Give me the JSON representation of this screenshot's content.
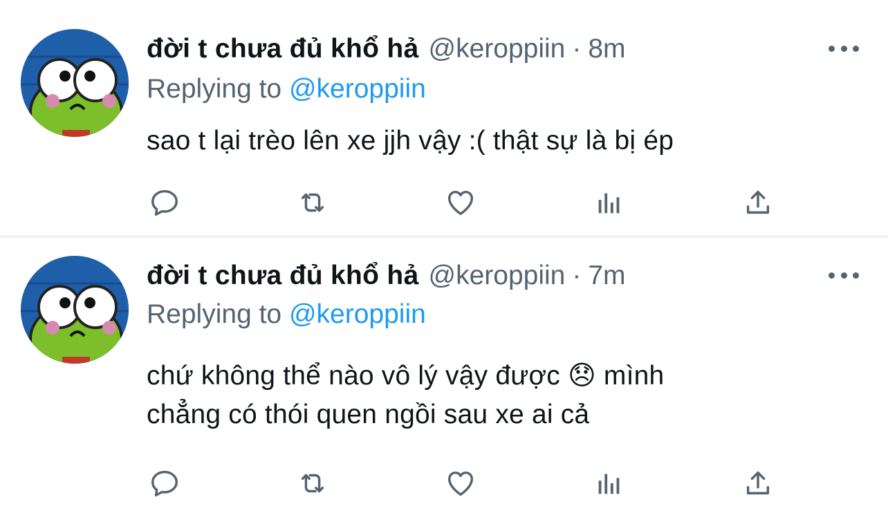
{
  "tweets": [
    {
      "name": "đời t chưa đủ khổ hả",
      "handle": "@keroppiin",
      "separator": "·",
      "time": "8m",
      "replying_label": "Replying to",
      "replying_to": "@keroppiin",
      "text_lines": [
        "sao t lại trèo lên xe jjh vậy :( thật sự là bị ép"
      ]
    },
    {
      "name": "đời t chưa đủ khổ hả",
      "handle": "@keroppiin",
      "separator": "·",
      "time": "7m",
      "replying_label": "Replying to",
      "replying_to": "@keroppiin",
      "text_lines": [
        "chứ không thể nào vô lý vậy được 😞  mình",
        "chẳng có thói quen ngồi sau xe ai cả"
      ]
    }
  ],
  "actions": [
    "reply-icon",
    "retweet-icon",
    "like-icon",
    "analytics-icon",
    "share-icon"
  ],
  "colors": {
    "text": "#0f1419",
    "secondary": "#536471",
    "link": "#1d9bf0",
    "divider": "#eff3f4"
  }
}
